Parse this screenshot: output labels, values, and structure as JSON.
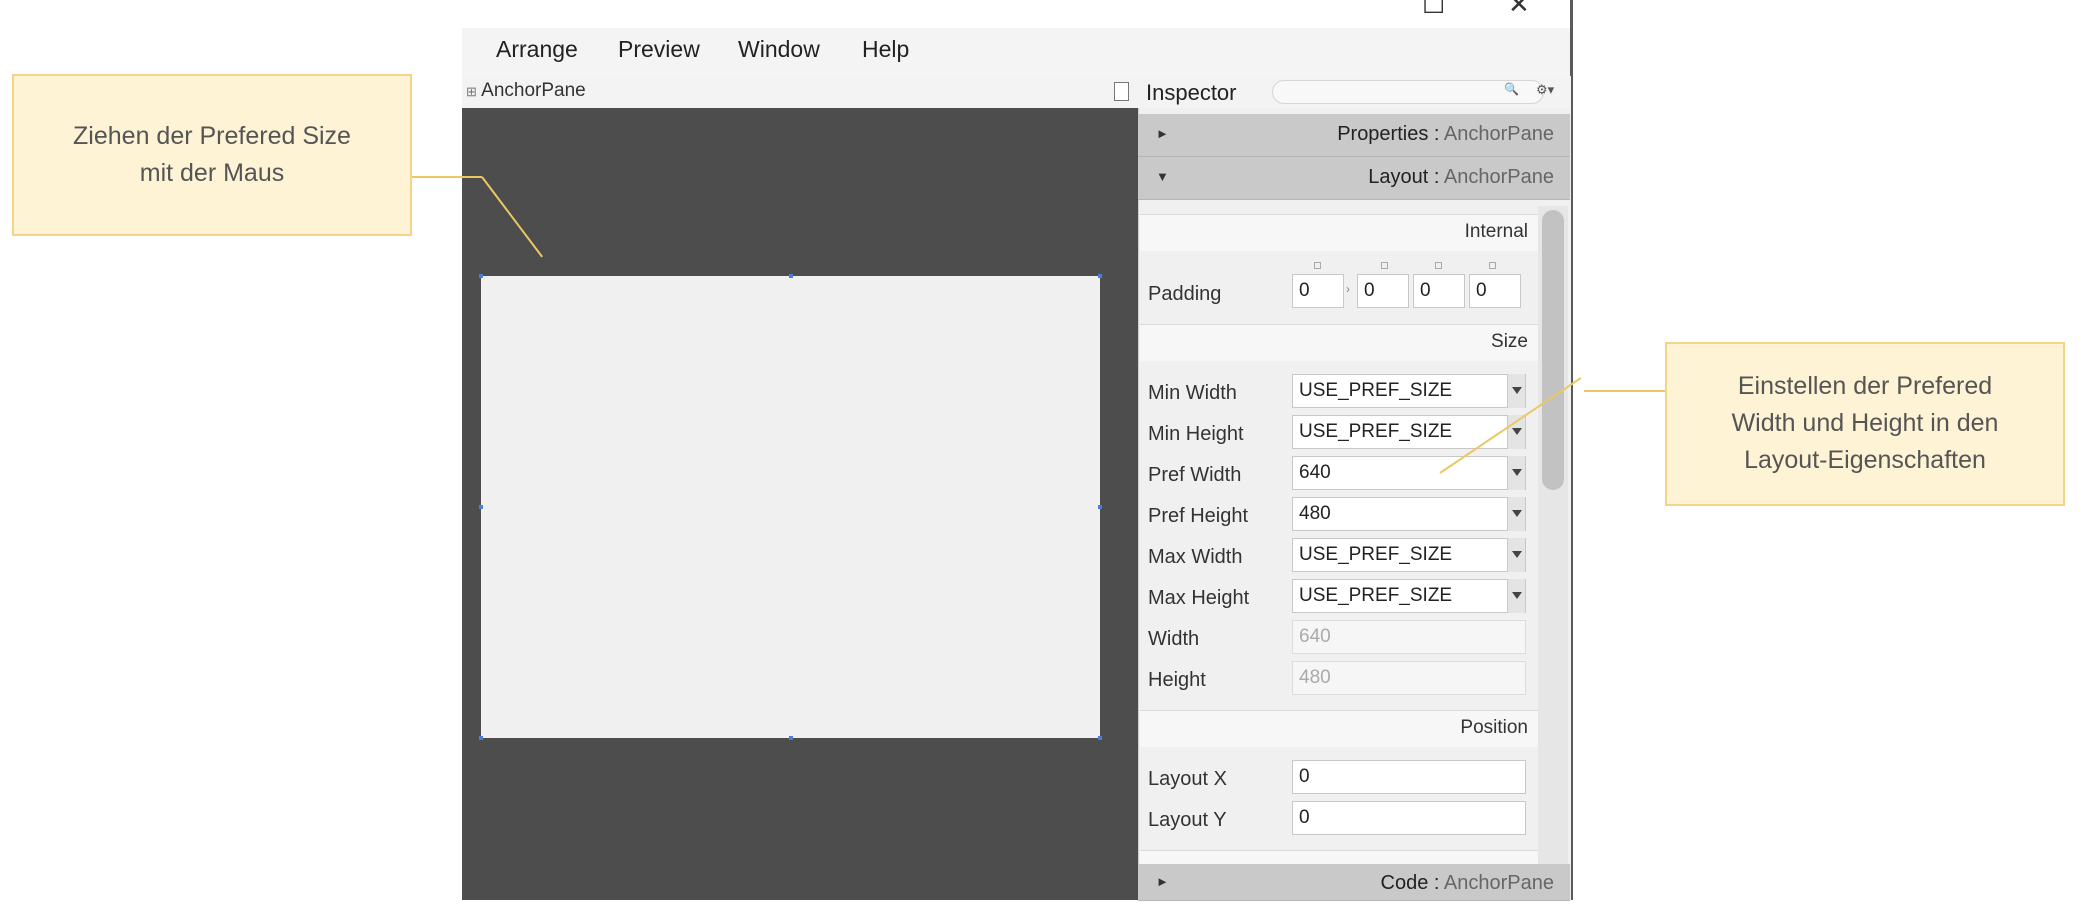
{
  "window": {
    "maximize_glyph": "☐",
    "close_glyph": "✕"
  },
  "menubar": {
    "items": [
      "Arrange",
      "Preview",
      "Window",
      "Help"
    ]
  },
  "canvas": {
    "title": "AnchorPane",
    "title_icon_glyph": "⊞"
  },
  "inspector": {
    "title": "Inspector",
    "search_icon": "search-icon",
    "search_glyph": "🔍",
    "settings_glyph": "⚙▾",
    "sections": {
      "properties": {
        "arrow": "►",
        "label": "Properties",
        "sep": " : ",
        "type": "AnchorPane"
      },
      "layout": {
        "arrow": "▼",
        "label": "Layout",
        "sep": " : ",
        "type": "AnchorPane"
      },
      "code": {
        "arrow": "►",
        "label": "Code",
        "sep": " : ",
        "type": "AnchorPane"
      }
    },
    "subsections": {
      "internal": "Internal",
      "size": "Size",
      "position": "Position"
    },
    "padding": {
      "label": "Padding",
      "values": [
        "0",
        "0",
        "0",
        "0"
      ],
      "separator": "›"
    },
    "size_rows": [
      {
        "label": "Min Width",
        "value": "USE_PREF_SIZE"
      },
      {
        "label": "Min Height",
        "value": "USE_PREF_SIZE"
      },
      {
        "label": "Pref Width",
        "value": "640"
      },
      {
        "label": "Pref Height",
        "value": "480"
      },
      {
        "label": "Max Width",
        "value": "USE_PREF_SIZE"
      },
      {
        "label": "Max Height",
        "value": "USE_PREF_SIZE"
      }
    ],
    "readonly_rows": [
      {
        "label": "Width",
        "value": "640"
      },
      {
        "label": "Height",
        "value": "480"
      }
    ],
    "position_rows": [
      {
        "label": "Layout X",
        "value": "0"
      },
      {
        "label": "Layout Y",
        "value": "0"
      }
    ]
  },
  "callouts": {
    "left": {
      "lines": [
        "Ziehen der Prefered Size",
        "mit der Maus"
      ]
    },
    "right": {
      "lines": [
        "Einstellen der Prefered",
        "Width und Height in den",
        "Layout-Eigenschaften"
      ]
    }
  },
  "colors": {
    "canvas_bg": "#4d4d4d",
    "pane_bg": "#f0f0f0",
    "section_bar": "#c9c9c9",
    "callout_bg": "#fef3d5",
    "callout_border": "#f3d488",
    "handle": "#4a7fd6"
  }
}
